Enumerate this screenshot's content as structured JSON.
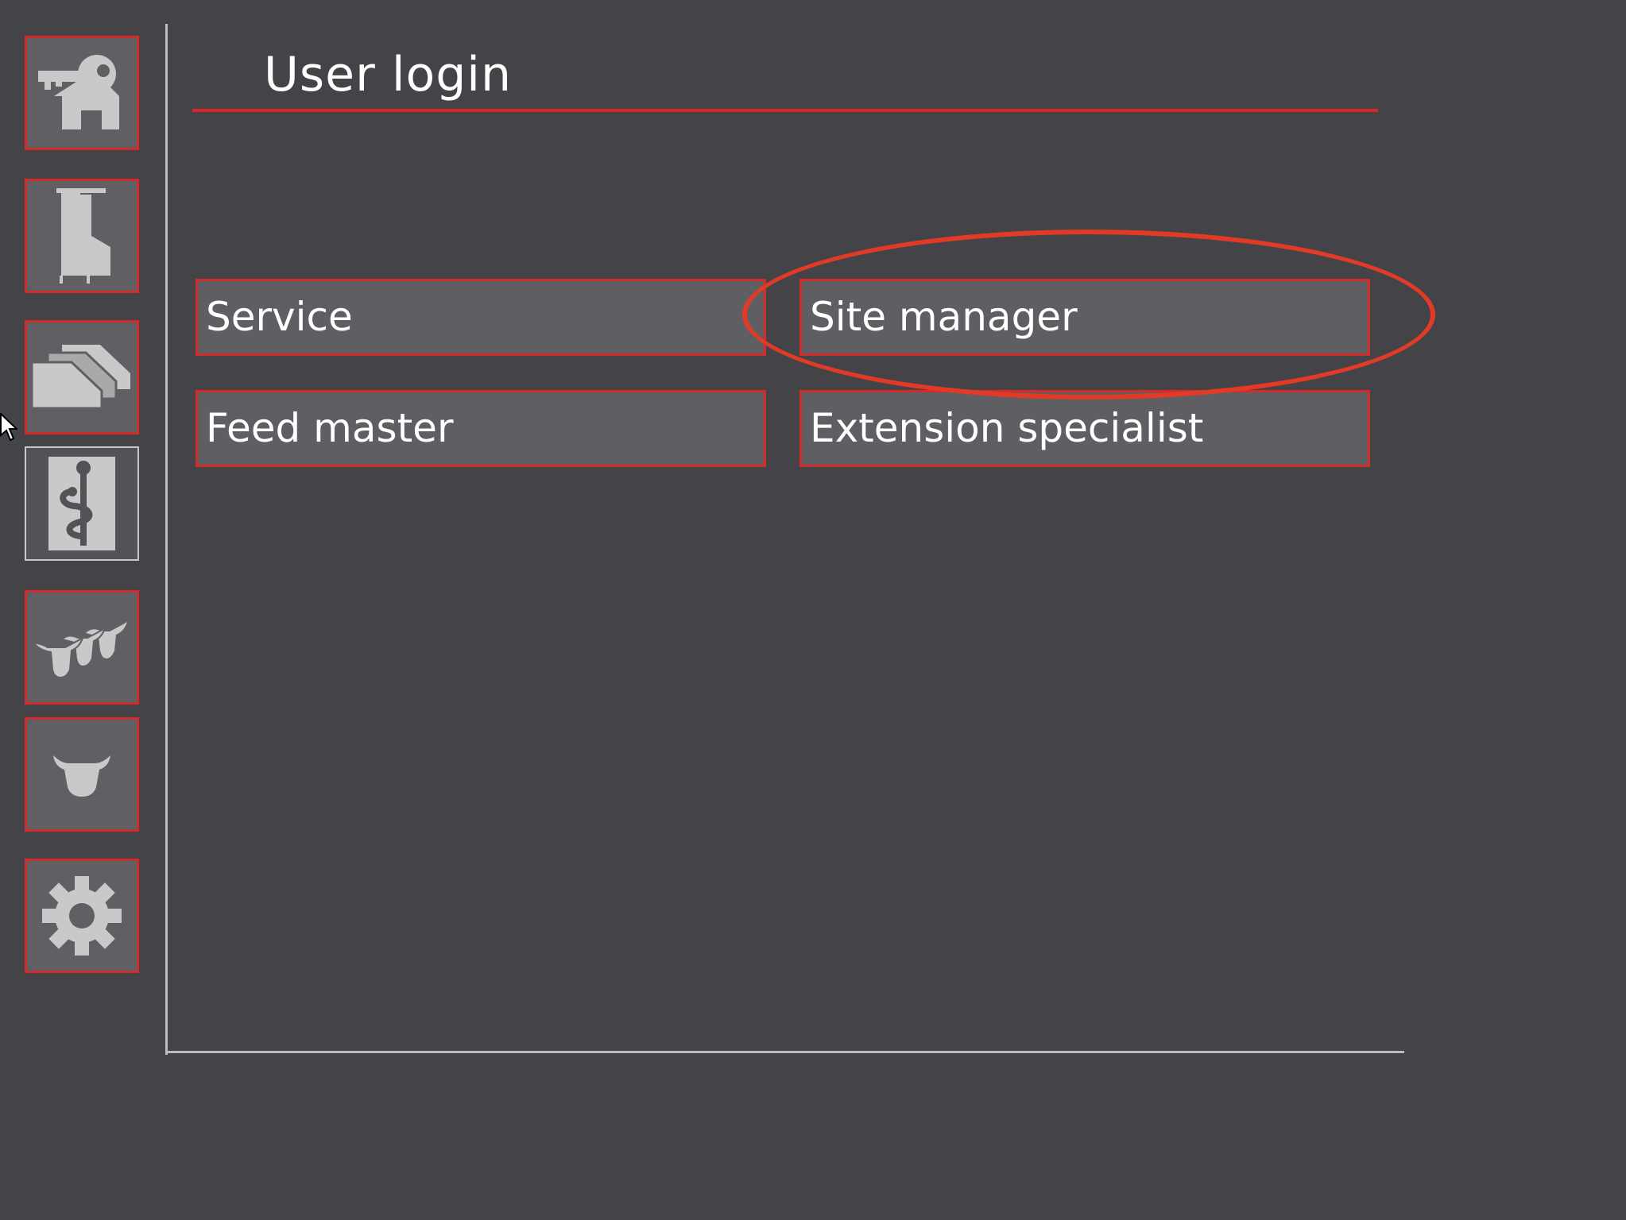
{
  "page": {
    "title": "User login"
  },
  "sidebar": {
    "items": [
      {
        "name": "login",
        "icon": "key-house-icon"
      },
      {
        "name": "robot",
        "icon": "feed-station-icon"
      },
      {
        "name": "layers",
        "icon": "stacked-layers-icon"
      },
      {
        "name": "health",
        "icon": "veterinary-caduceus-icon",
        "active": true
      },
      {
        "name": "herd",
        "icon": "cow-herd-icon"
      },
      {
        "name": "animal",
        "icon": "cow-head-icon"
      },
      {
        "name": "settings",
        "icon": "gear-icon"
      }
    ]
  },
  "users": {
    "service": "Service",
    "site_manager": "Site manager",
    "feed_master": "Feed master",
    "extension_specialist": "Extension specialist"
  },
  "colors": {
    "background": "#444347",
    "accent": "#e02424",
    "button": "#5f5e63",
    "highlight": "#e33a28"
  }
}
